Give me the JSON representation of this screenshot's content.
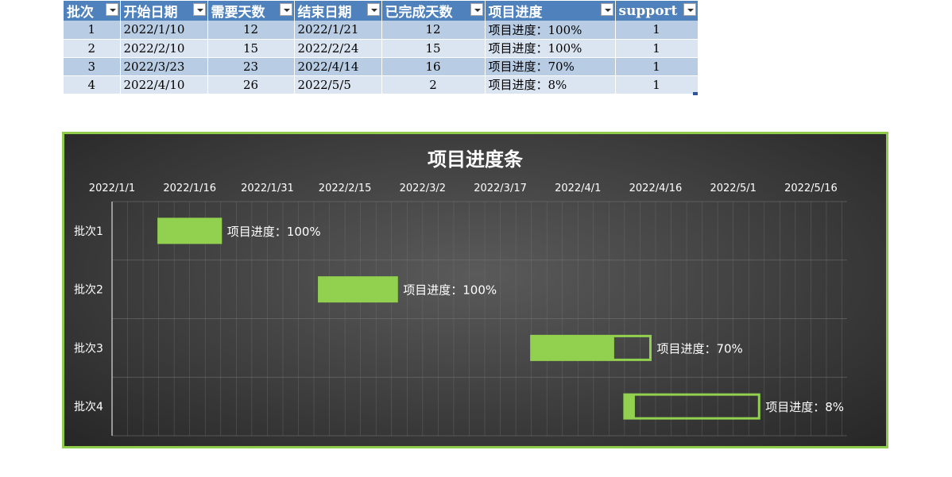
{
  "table": {
    "headers": [
      "批次",
      "开始日期",
      "需要天数",
      "结束日期",
      "已完成天数",
      "项目进度",
      "support"
    ],
    "rows": [
      [
        "1",
        "2022/1/10",
        "12",
        "2022/1/21",
        "12",
        "项目进度：100%",
        "1"
      ],
      [
        "2",
        "2022/2/10",
        "15",
        "2022/2/24",
        "15",
        "项目进度：100%",
        "1"
      ],
      [
        "3",
        "2022/3/23",
        "23",
        "2022/4/14",
        "16",
        "项目进度：70%",
        "1"
      ],
      [
        "4",
        "2022/4/10",
        "26",
        "2022/5/5",
        "2",
        "项目进度：8%",
        "1"
      ]
    ]
  },
  "chart_data": {
    "type": "bar",
    "subtype": "gantt",
    "title": "项目进度条",
    "x_axis": {
      "type": "date",
      "range": [
        "2022/1/1",
        "2022/5/23"
      ],
      "tick_labels": [
        "2022/1/1",
        "2022/1/16",
        "2022/1/31",
        "2022/2/15",
        "2022/3/2",
        "2022/3/17",
        "2022/4/1",
        "2022/4/16",
        "2022/5/1",
        "2022/5/16"
      ],
      "minor_gridline_days": 3,
      "position": "top"
    },
    "categories": [
      "批次1",
      "批次2",
      "批次3",
      "批次4"
    ],
    "tasks": [
      {
        "category": "批次1",
        "start": "2022/1/10",
        "duration_days": 12,
        "completed_days": 12,
        "label": "项目进度：100%"
      },
      {
        "category": "批次2",
        "start": "2022/2/10",
        "duration_days": 15,
        "completed_days": 15,
        "label": "项目进度：100%"
      },
      {
        "category": "批次3",
        "start": "2022/3/23",
        "duration_days": 23,
        "completed_days": 16,
        "label": "项目进度：70%"
      },
      {
        "category": "批次4",
        "start": "2022/4/10",
        "duration_days": 26,
        "completed_days": 2,
        "label": "项目进度：8%"
      }
    ],
    "grid": true,
    "legend": "none",
    "colors": {
      "fill": "#92d050",
      "outline": "#92d050",
      "text": "#ffffff",
      "grid": "#777777",
      "border": "#8fcc4a"
    }
  }
}
